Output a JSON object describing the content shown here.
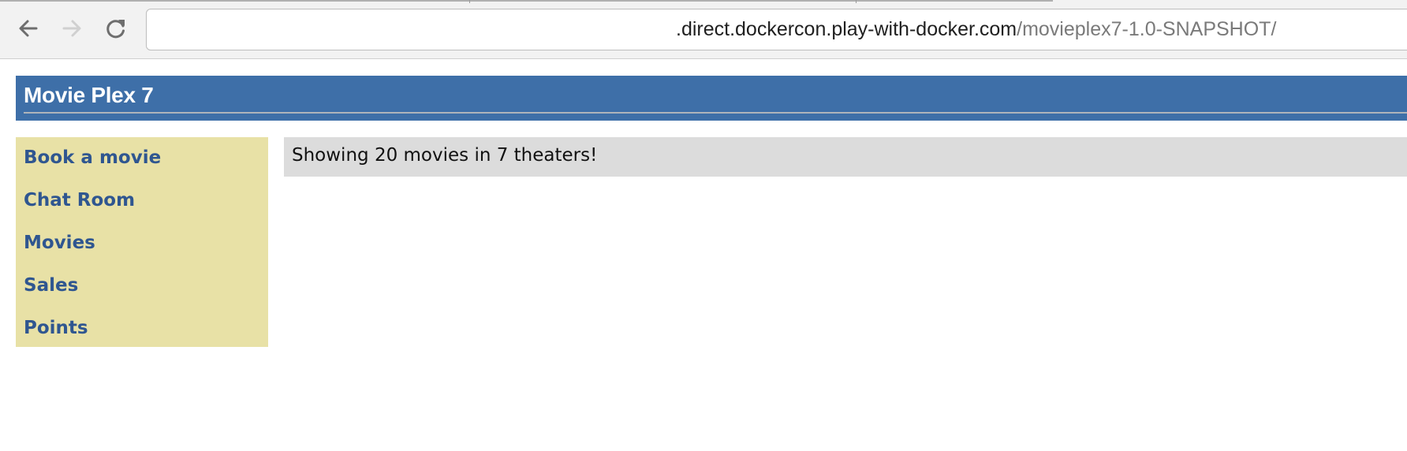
{
  "browser": {
    "back_icon": "arrow-left",
    "forward_icon": "arrow-right",
    "reload_icon": "reload",
    "url_host": ".direct.dockercon.play-with-docker.com",
    "url_path": "/movieplex7-1.0-SNAPSHOT/",
    "colors": {
      "toolbar": "#f2f2f2",
      "url_host": "#1f1f1f",
      "url_path": "#7a7a7a"
    }
  },
  "header": {
    "title": "Movie Plex 7",
    "color": "#3e6fa8"
  },
  "sidebar": {
    "color": "#e8e1a6",
    "link_color": "#2f5690",
    "items": [
      {
        "label": "Book a movie"
      },
      {
        "label": "Chat Room"
      },
      {
        "label": "Movies"
      },
      {
        "label": "Sales"
      },
      {
        "label": "Points"
      }
    ]
  },
  "main": {
    "banner_text": "Showing 20 movies in 7 theaters!",
    "banner_color": "#dcdcdc"
  }
}
